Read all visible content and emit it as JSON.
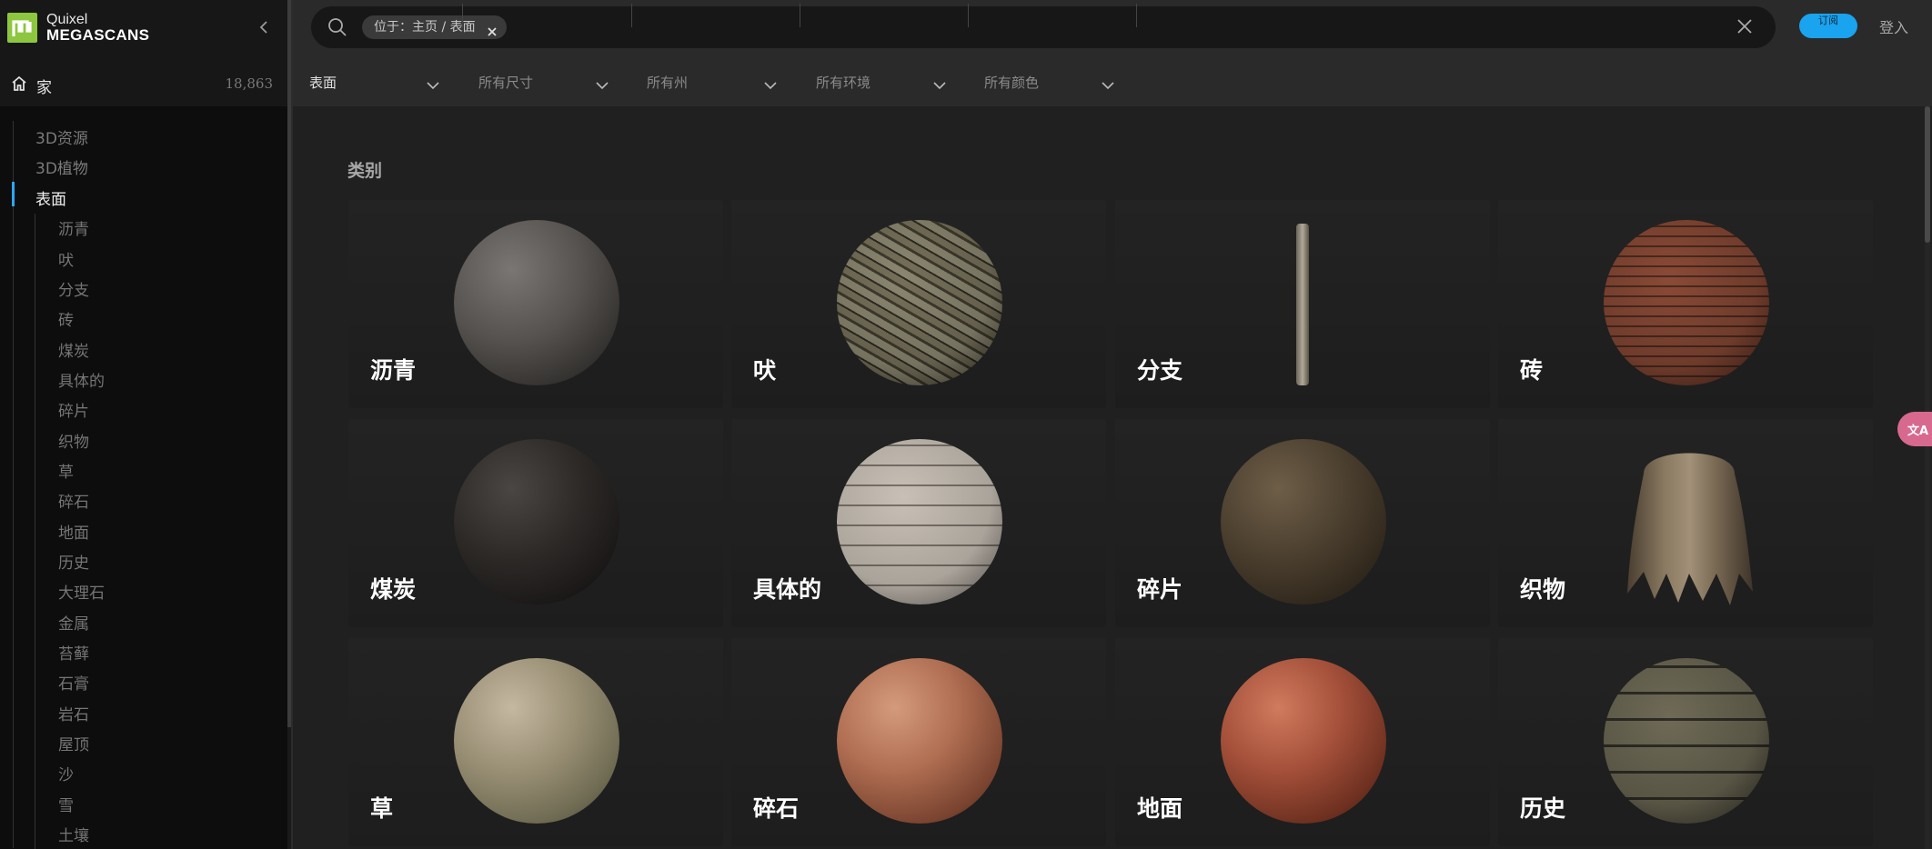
{
  "sidebar": {
    "brand_top": "Quixel",
    "brand_bottom": "MEGASCANS",
    "home": {
      "label": "家",
      "count": "18,863"
    },
    "top_items": [
      {
        "label": "3D资源"
      },
      {
        "label": "3D植物"
      },
      {
        "label": "表面",
        "active": true
      }
    ],
    "sub_items": [
      {
        "label": "沥青"
      },
      {
        "label": "吠"
      },
      {
        "label": "分支"
      },
      {
        "label": "砖"
      },
      {
        "label": "煤炭"
      },
      {
        "label": "具体的"
      },
      {
        "label": "碎片"
      },
      {
        "label": "织物"
      },
      {
        "label": "草"
      },
      {
        "label": "碎石"
      },
      {
        "label": "地面"
      },
      {
        "label": "历史"
      },
      {
        "label": "大理石"
      },
      {
        "label": "金属"
      },
      {
        "label": "苔藓"
      },
      {
        "label": "石膏"
      },
      {
        "label": "岩石"
      },
      {
        "label": "屋顶"
      },
      {
        "label": "沙"
      },
      {
        "label": "雪"
      },
      {
        "label": "土壤"
      }
    ]
  },
  "search": {
    "chip": "位于：主页 / 表面"
  },
  "header": {
    "subscribe": "订阅",
    "login": "登入"
  },
  "filters": [
    {
      "label": "表面",
      "active": true
    },
    {
      "label": "所有尺寸"
    },
    {
      "label": "所有州"
    },
    {
      "label": "所有环境"
    },
    {
      "label": "所有颜色"
    }
  ],
  "main": {
    "section_title": "类别",
    "categories": [
      {
        "label": "沥青",
        "style": "asphalt"
      },
      {
        "label": "吠",
        "style": "bark"
      },
      {
        "label": "分支",
        "style": "branch"
      },
      {
        "label": "砖",
        "style": "brick"
      },
      {
        "label": "煤炭",
        "style": "coal"
      },
      {
        "label": "具体的",
        "style": "concrete"
      },
      {
        "label": "碎片",
        "style": "debris"
      },
      {
        "label": "织物",
        "style": "fabric"
      },
      {
        "label": "草",
        "style": "grass"
      },
      {
        "label": "碎石",
        "style": "gravel"
      },
      {
        "label": "地面",
        "style": "ground"
      },
      {
        "label": "历史",
        "style": "historic"
      }
    ]
  },
  "colors": {
    "accent": "#29a8ff",
    "subscribe_bg": "#1aa3ef",
    "logo_green": "#8dc63f",
    "translate_pink": "#d8698e"
  },
  "icons": [
    "megascans-logo-icon",
    "collapse-chevron-icon",
    "home-icon",
    "search-icon",
    "close-icon",
    "chevron-down-icon",
    "translate-icon"
  ]
}
